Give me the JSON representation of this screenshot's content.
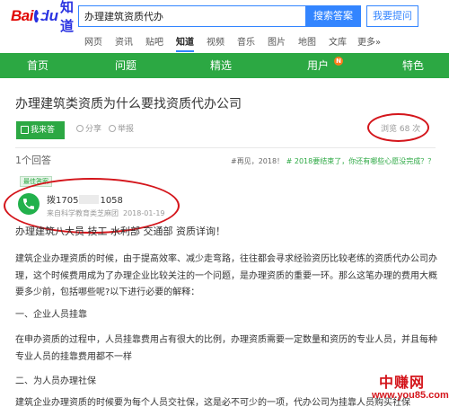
{
  "brand": {
    "bai": "Bai",
    "du": "du",
    "zhidao": "知道"
  },
  "search": {
    "value": "办理建筑资质代办",
    "button": "搜索答案",
    "ask": "我要提问"
  },
  "catnav": [
    {
      "label": "网页"
    },
    {
      "label": "资讯"
    },
    {
      "label": "贴吧"
    },
    {
      "label": "知道"
    },
    {
      "label": "视频"
    },
    {
      "label": "音乐"
    },
    {
      "label": "图片"
    },
    {
      "label": "地图"
    },
    {
      "label": "文库"
    },
    {
      "label": "更多»"
    }
  ],
  "greennav": [
    {
      "label": "首页"
    },
    {
      "label": "问题"
    },
    {
      "label": "精选"
    },
    {
      "label": "用户"
    },
    {
      "label": "特色"
    }
  ],
  "greennav_badge": "N",
  "question": {
    "title": "办理建筑类资质为什么要找资质代办公司",
    "answer_button": "我来答",
    "share": "分享",
    "report": "举报",
    "views": "浏览 68 次"
  },
  "answers": {
    "count": "1个回答",
    "links_prefix": "#",
    "links_text": "再见，2018！",
    "links_highlight": "# 2018要结束了，你还有哪些心愿没完成？？",
    "best_tag": "最佳答案"
  },
  "answerer": {
    "name_prefix": "拨1705",
    "name_suffix": "1058",
    "subtitle": "来自科学教育类芝麻团",
    "date": "2018-01-19"
  },
  "body": {
    "headline": "办理建筑八大员 技工 水利部 交通部 资质详询！",
    "p1": "建筑企业办理资质的时候，由于提高效率、减少走弯路，往往都会寻求经验资历比较老练的资质代办公司办理，这个时候费用成为了办理企业比较关注的一个问题，是办理资质的重要一环。那么这笔办理的费用大概要多少前，包括哪些呢?以下进行必要的解释：",
    "h1": "一、企业人员挂靠",
    "p2": "在申办资质的过程中，人员挂靠费用占有很大的比例，办理资质需要一定数量和资历的专业人员，并且每种专业人员的挂靠费用都不一样",
    "h2": "二、为人员办理社保",
    "p3": "建筑企业办理资质的时候要为每个人员交社保，这是必不可少的一项，代办公司为挂靠人员购买社保"
  },
  "watermark": {
    "cn": "中赚网",
    "url": "www.you85.com"
  },
  "colors": {
    "green": "#2ca843",
    "blue": "#3385ff",
    "red": "#d4151b"
  },
  "icons": [
    "pencil-icon",
    "share-icon",
    "report-icon",
    "phone-icon"
  ]
}
